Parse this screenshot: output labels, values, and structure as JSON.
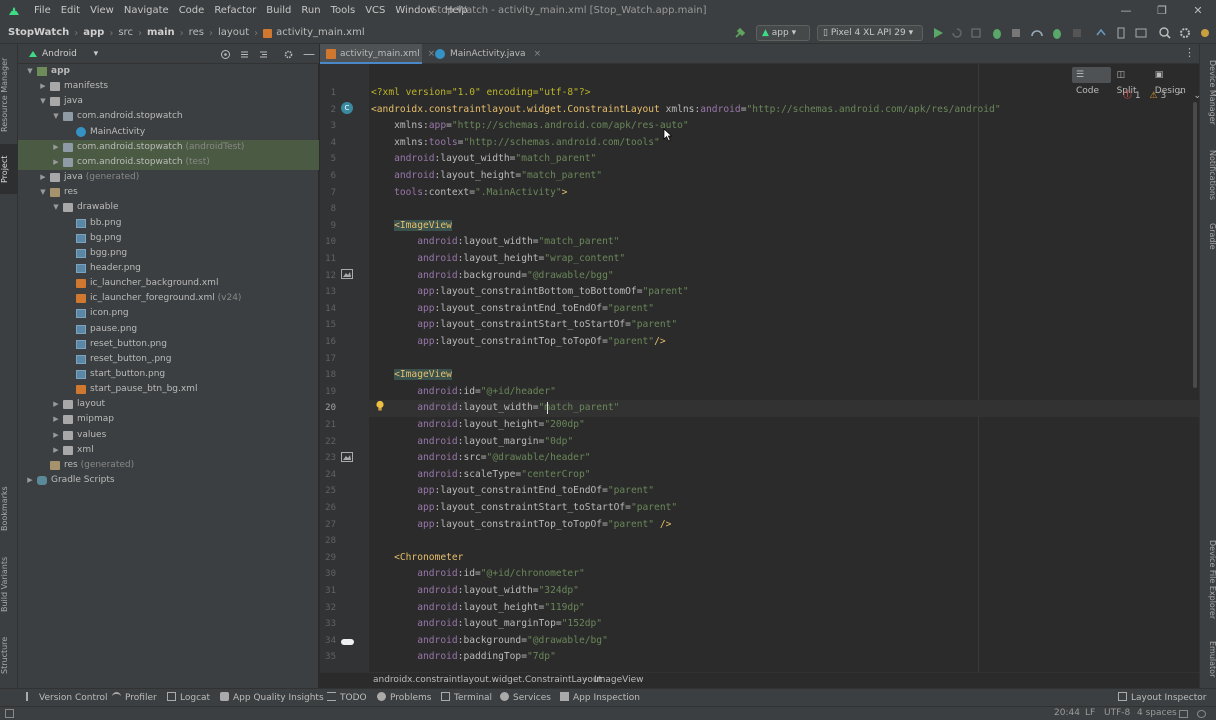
{
  "menu": [
    "File",
    "Edit",
    "View",
    "Navigate",
    "Code",
    "Refactor",
    "Build",
    "Run",
    "Tools",
    "VCS",
    "Window",
    "Help"
  ],
  "window_title": "Stop Watch - activity_main.xml [Stop_Watch.app.main]",
  "window_controls": {
    "minimize": "—",
    "maximize": "❐",
    "close": "✕"
  },
  "breadcrumbs": [
    "StopWatch",
    "app",
    "src",
    "main",
    "res",
    "layout",
    "activity_main.xml"
  ],
  "toolbar": {
    "run_config": "app",
    "device": "Pixel 4 XL API 29"
  },
  "project_panel": {
    "view_mode": "Android"
  },
  "tree": [
    {
      "label": "app",
      "suffix": "",
      "depth": 0,
      "expanded": true,
      "icon": "module",
      "bold": true
    },
    {
      "label": "manifests",
      "suffix": "",
      "depth": 1,
      "expanded": false,
      "icon": "folder"
    },
    {
      "label": "java",
      "suffix": "",
      "depth": 1,
      "expanded": true,
      "icon": "folder"
    },
    {
      "label": "com.android.stopwatch",
      "suffix": "",
      "depth": 2,
      "expanded": true,
      "icon": "package"
    },
    {
      "label": "MainActivity",
      "suffix": "",
      "depth": 3,
      "leaf": true,
      "icon": "class"
    },
    {
      "label": "com.android.stopwatch",
      "suffix": " (androidTest)",
      "depth": 2,
      "expanded": false,
      "icon": "package",
      "selected": true
    },
    {
      "label": "com.android.stopwatch",
      "suffix": " (test)",
      "depth": 2,
      "expanded": false,
      "icon": "package",
      "selected": true
    },
    {
      "label": "java",
      "suffix": " (generated)",
      "depth": 1,
      "expanded": false,
      "icon": "folder"
    },
    {
      "label": "res",
      "suffix": "",
      "depth": 1,
      "expanded": true,
      "icon": "res"
    },
    {
      "label": "drawable",
      "suffix": "",
      "depth": 2,
      "expanded": true,
      "icon": "folder"
    },
    {
      "label": "bb.png",
      "suffix": "",
      "depth": 3,
      "leaf": true,
      "icon": "image"
    },
    {
      "label": "bg.png",
      "suffix": "",
      "depth": 3,
      "leaf": true,
      "icon": "image"
    },
    {
      "label": "bgg.png",
      "suffix": "",
      "depth": 3,
      "leaf": true,
      "icon": "image"
    },
    {
      "label": "header.png",
      "suffix": "",
      "depth": 3,
      "leaf": true,
      "icon": "image"
    },
    {
      "label": "ic_launcher_background.xml",
      "suffix": "",
      "depth": 3,
      "leaf": true,
      "icon": "xml"
    },
    {
      "label": "ic_launcher_foreground.xml",
      "suffix": " (v24)",
      "depth": 3,
      "leaf": true,
      "icon": "xml"
    },
    {
      "label": "icon.png",
      "suffix": "",
      "depth": 3,
      "leaf": true,
      "icon": "image"
    },
    {
      "label": "pause.png",
      "suffix": "",
      "depth": 3,
      "leaf": true,
      "icon": "image"
    },
    {
      "label": "reset_button.png",
      "suffix": "",
      "depth": 3,
      "leaf": true,
      "icon": "image"
    },
    {
      "label": "reset_button_.png",
      "suffix": "",
      "depth": 3,
      "leaf": true,
      "icon": "image"
    },
    {
      "label": "start_button.png",
      "suffix": "",
      "depth": 3,
      "leaf": true,
      "icon": "image"
    },
    {
      "label": "start_pause_btn_bg.xml",
      "suffix": "",
      "depth": 3,
      "leaf": true,
      "icon": "xml"
    },
    {
      "label": "layout",
      "suffix": "",
      "depth": 2,
      "expanded": false,
      "icon": "folder"
    },
    {
      "label": "mipmap",
      "suffix": "",
      "depth": 2,
      "expanded": false,
      "icon": "folder"
    },
    {
      "label": "values",
      "suffix": "",
      "depth": 2,
      "expanded": false,
      "icon": "folder"
    },
    {
      "label": "xml",
      "suffix": "",
      "depth": 2,
      "expanded": false,
      "icon": "folder"
    },
    {
      "label": "res",
      "suffix": " (generated)",
      "depth": 1,
      "leaf": true,
      "icon": "res"
    },
    {
      "label": "Gradle Scripts",
      "suffix": "",
      "depth": 0,
      "expanded": false,
      "icon": "gradle"
    }
  ],
  "left_tabs": {
    "resource_manager": "Resource Manager",
    "project": "Project",
    "bookmarks": "Bookmarks",
    "build_variants": "Build Variants",
    "structure": "Structure"
  },
  "right_tabs": {
    "device_manager": "Device Manager",
    "notifications": "Notifications",
    "gradle": "Gradle",
    "device_file_explorer": "Device File Explorer",
    "emulator": "Emulator"
  },
  "editor_tabs": [
    {
      "label": "activity_main.xml",
      "active": true
    },
    {
      "label": "MainActivity.java",
      "active": false
    }
  ],
  "editor_modes": {
    "code": "Code",
    "split": "Split",
    "design": "Design"
  },
  "inspections": {
    "errors": "1",
    "warnings": "3"
  },
  "current_line": 20,
  "code_lines": [
    "<?xml version=\"1.0\" encoding=\"utf-8\"?>",
    "<androidx.constraintlayout.widget.ConstraintLayout xmlns:android=\"http://schemas.android.com/apk/res/android\"",
    "    xmlns:app=\"http://schemas.android.com/apk/res-auto\"",
    "    xmlns:tools=\"http://schemas.android.com/tools\"",
    "    android:layout_width=\"match_parent\"",
    "    android:layout_height=\"match_parent\"",
    "    tools:context=\".MainActivity\">",
    "",
    "    <ImageView",
    "        android:layout_width=\"match_parent\"",
    "        android:layout_height=\"wrap_content\"",
    "        android:background=\"@drawable/bgg\"",
    "        app:layout_constraintBottom_toBottomOf=\"parent\"",
    "        app:layout_constraintEnd_toEndOf=\"parent\"",
    "        app:layout_constraintStart_toStartOf=\"parent\"",
    "        app:layout_constraintTop_toTopOf=\"parent\"/>",
    "",
    "    <ImageView",
    "        android:id=\"@+id/header\"",
    "        android:layout_width=\"match_parent\"",
    "        android:layout_height=\"200dp\"",
    "        android:layout_margin=\"0dp\"",
    "        android:src=\"@drawable/header\"",
    "        android:scaleType=\"centerCrop\"",
    "        app:layout_constraintEnd_toEndOf=\"parent\"",
    "        app:layout_constraintStart_toStartOf=\"parent\"",
    "        app:layout_constraintTop_toTopOf=\"parent\" />",
    "",
    "    <Chronometer",
    "        android:id=\"@+id/chronometer\"",
    "        android:layout_width=\"324dp\"",
    "        android:layout_height=\"119dp\"",
    "        android:layout_marginTop=\"152dp\"",
    "        android:background=\"@drawable/bg\"",
    "        android:paddingTop=\"7dp\""
  ],
  "editor_breadcrumb": [
    "androidx.constraintlayout.widget.ConstraintLayout",
    "ImageView"
  ],
  "bottom_tabs": [
    "Version Control",
    "Profiler",
    "Logcat",
    "App Quality Insights",
    "TODO",
    "Problems",
    "Terminal",
    "Services",
    "App Inspection",
    "Layout Inspector"
  ],
  "status": {
    "time": "20:44",
    "line_sep": "LF",
    "encoding": "UTF-8",
    "indent": "4 spaces"
  }
}
